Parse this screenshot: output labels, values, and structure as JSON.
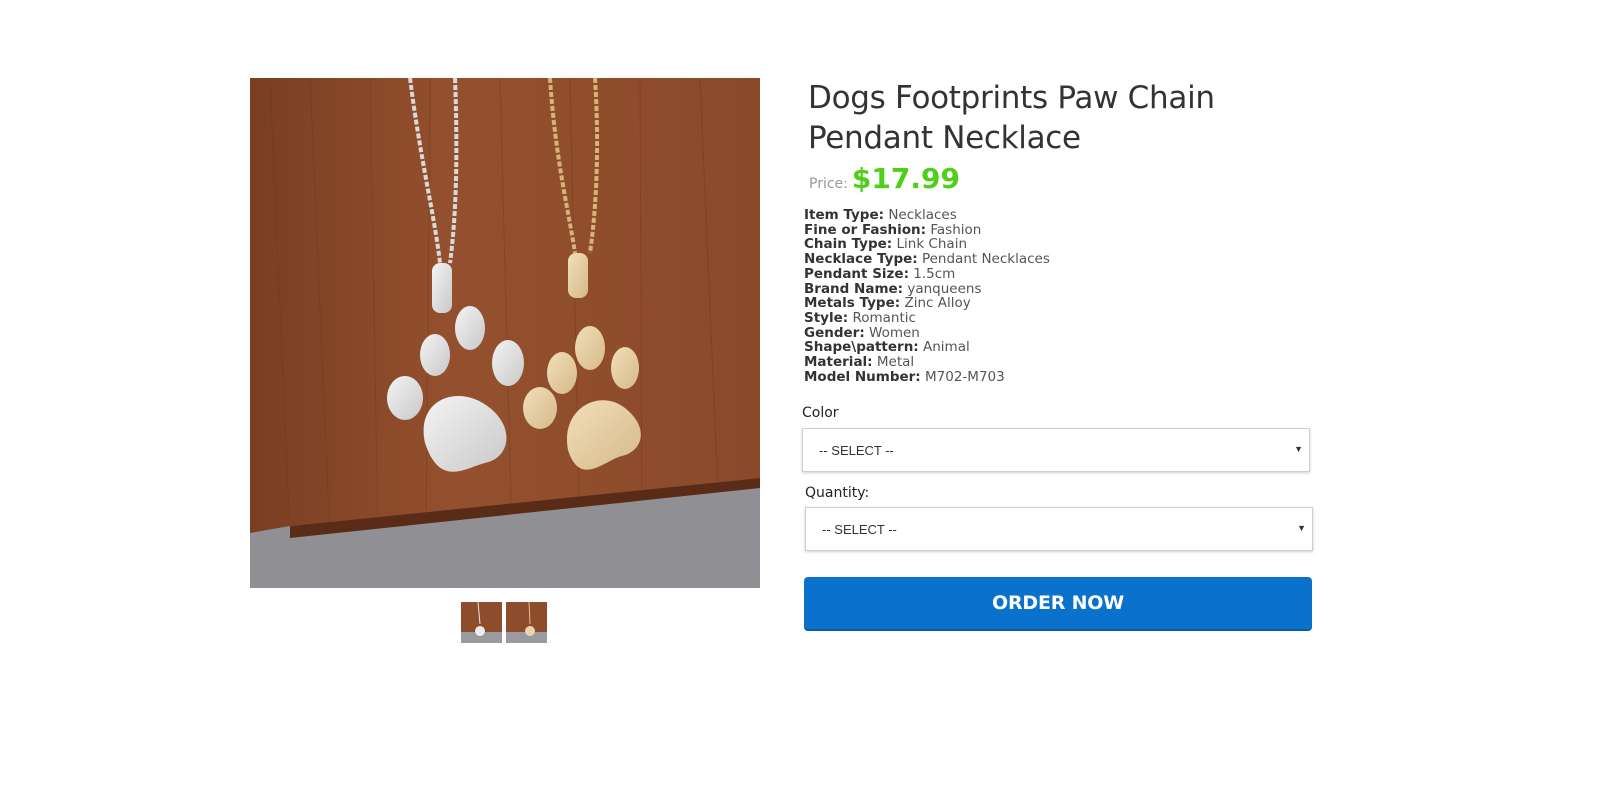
{
  "product": {
    "title": "Dogs Footprints Paw Chain Pendant Necklace",
    "price_label": "Price:",
    "price": "$17.99",
    "price_color": "#4fcf19"
  },
  "gallery": {
    "main_image": "silver and gold paw pendant necklaces on wooden block",
    "thumbnails": [
      "silver paw pendant thumbnail",
      "gold paw pendant thumbnail"
    ]
  },
  "specs": [
    {
      "key": "Item Type:",
      "value": "Necklaces"
    },
    {
      "key": "Fine or Fashion:",
      "value": "Fashion"
    },
    {
      "key": "Chain Type:",
      "value": "Link Chain"
    },
    {
      "key": "Necklace Type:",
      "value": "Pendant Necklaces"
    },
    {
      "key": "Pendant Size:",
      "value": "1.5cm"
    },
    {
      "key": "Brand Name:",
      "value": "yanqueens"
    },
    {
      "key": "Metals Type:",
      "value": "Zinc Alloy"
    },
    {
      "key": "Style:",
      "value": "Romantic"
    },
    {
      "key": "Gender:",
      "value": "Women"
    },
    {
      "key": "Shape\\pattern:",
      "value": "Animal"
    },
    {
      "key": "Material:",
      "value": "Metal"
    },
    {
      "key": "Model Number:",
      "value": "M702-M703"
    }
  ],
  "color_select": {
    "label": "Color",
    "selected": "-- SELECT --"
  },
  "quantity_select": {
    "label": "Quantity:",
    "selected": "-- SELECT --"
  },
  "order_button": {
    "label": "ORDER NOW",
    "color": "#0a72cc"
  }
}
